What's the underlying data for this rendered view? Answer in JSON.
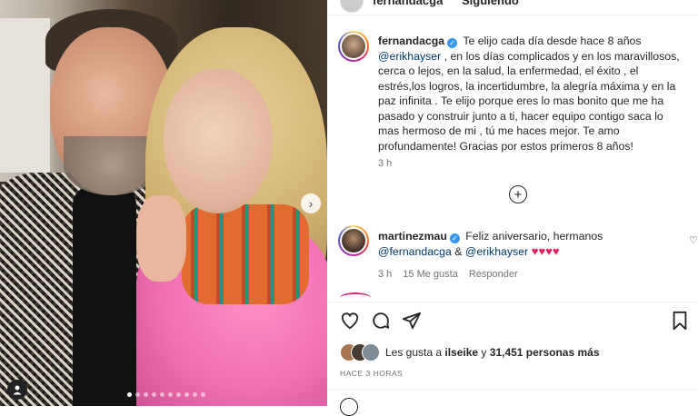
{
  "post": {
    "username": "fernandacga",
    "header_status": "Siguiendo",
    "caption_username": "fernandacga",
    "caption_parts": {
      "p1": " Te elijo cada día desde hace 8 años ",
      "mention1": "@erikhayser",
      "p2": " , en los días complicados y en los maravillosos, cerca o lejos, en la salud, la enfermedad, el éxito , el estrés,los logros, la incertidumbre, la alegría máxima y en la paz infinita . Te elijo porque eres lo mas bonito que me ha pasado y construir junto a ti, hacer equipo contigo saca lo mas hermoso de mi , tú me haces mejor. Te amo profundamente! Gracias por estos primeros 8 años!"
    },
    "caption_time": "3 h",
    "load_more": "+",
    "comment": {
      "username": "martinezmau",
      "text": " Feliz aniversario, hermanos ",
      "mention1": "@fernandacga",
      "amp": " & ",
      "mention2": "@erikhayser",
      "hearts": " ♥♥♥♥",
      "time": "3 h",
      "likes": "15 Me gusta",
      "reply": "Responder"
    },
    "likes_prefix": "Les gusta a ",
    "likes_user": "ilseike",
    "likes_mid": " y ",
    "likes_count": "31,451 personas más",
    "timestamp": "HACE 3 HORAS"
  },
  "icons": {
    "like": "heart-icon",
    "comment": "comment-icon",
    "share": "share-icon",
    "save": "bookmark-icon",
    "next": "chevron-right-icon",
    "add": "plus-circle-icon"
  },
  "colors": {
    "link": "#00376b",
    "verified": "#3897f0",
    "muted": "#737373",
    "heart": "#e0245e"
  }
}
